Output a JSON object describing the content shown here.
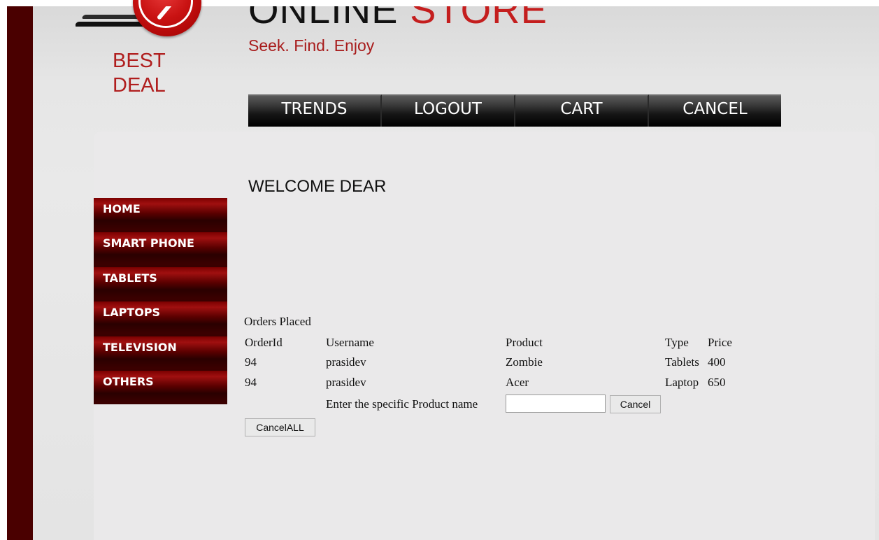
{
  "brand": {
    "logo_line1": "BEST",
    "logo_line2": "DEAL",
    "title_part1": "ONLINE",
    "title_part2": "STORE",
    "tagline": "Seek. Find. Enjoy",
    "colors": {
      "accent": "#b01e1e",
      "dark_bar": "#4a0000"
    }
  },
  "topnav": {
    "items": [
      "TRENDS",
      "LOGOUT",
      "CART",
      "CANCEL"
    ]
  },
  "sidebar": {
    "items": [
      {
        "label": "HOME"
      },
      {
        "label": "SMART PHONE"
      },
      {
        "label": "TABLETS"
      },
      {
        "label": "LAPTOPS"
      },
      {
        "label": "TELEVISION"
      },
      {
        "label": "OTHERS"
      }
    ]
  },
  "main": {
    "welcome": "WELCOME DEAR",
    "orders": {
      "caption": "Orders Placed",
      "headers": [
        "OrderId",
        "Username",
        "Product",
        "Type",
        "Price"
      ],
      "rows": [
        [
          "94",
          "prasidev",
          "Zombie",
          "Tablets",
          "400"
        ],
        [
          "94",
          "prasidev",
          "Acer",
          "Laptop",
          "650"
        ]
      ]
    },
    "cancel_form": {
      "label": "Enter the specific Product name",
      "input_value": "",
      "cancel_button": "Cancel",
      "cancel_all_button": "CancelALL"
    }
  }
}
